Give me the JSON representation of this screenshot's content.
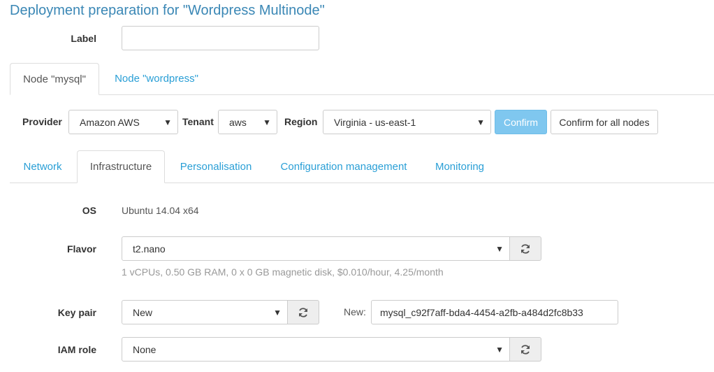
{
  "page": {
    "title": "Deployment preparation for \"Wordpress Multinode\""
  },
  "label_field": {
    "label": "Label",
    "value": "",
    "placeholder": ""
  },
  "node_tabs": [
    {
      "label": "Node \"mysql\"",
      "active": true
    },
    {
      "label": "Node \"wordpress\"",
      "active": false
    }
  ],
  "provider_bar": {
    "provider_label": "Provider",
    "provider_value": "Amazon AWS",
    "tenant_label": "Tenant",
    "tenant_value": "aws",
    "region_label": "Region",
    "region_value": "Virginia - us-east-1",
    "confirm_label": "Confirm",
    "confirm_all_label": "Confirm for all nodes"
  },
  "section_tabs": [
    {
      "label": "Network",
      "active": false
    },
    {
      "label": "Infrastructure",
      "active": true
    },
    {
      "label": "Personalisation",
      "active": false
    },
    {
      "label": "Configuration management",
      "active": false
    },
    {
      "label": "Monitoring",
      "active": false
    }
  ],
  "infrastructure": {
    "os_label": "OS",
    "os_value": "Ubuntu 14.04 x64",
    "flavor_label": "Flavor",
    "flavor_value": "t2.nano",
    "flavor_help": "1 vCPUs, 0.50 GB RAM, 0 x 0 GB magnetic disk, $0.010/hour, 4.25/month",
    "keypair_label": "Key pair",
    "keypair_value": "New",
    "new_label": "New:",
    "new_keypair_value": "mysql_c92f7aff-bda4-4454-a2fb-a484d2fc8b33",
    "iam_label": "IAM role",
    "iam_value": "None"
  },
  "icons": {
    "caret": "caret-down-icon",
    "refresh": "refresh-icon"
  },
  "colors": {
    "link": "#2a9fd6",
    "title": "#3a87b5",
    "primary_button": "#7fc7ef",
    "addon_bg": "#eeeeee"
  }
}
